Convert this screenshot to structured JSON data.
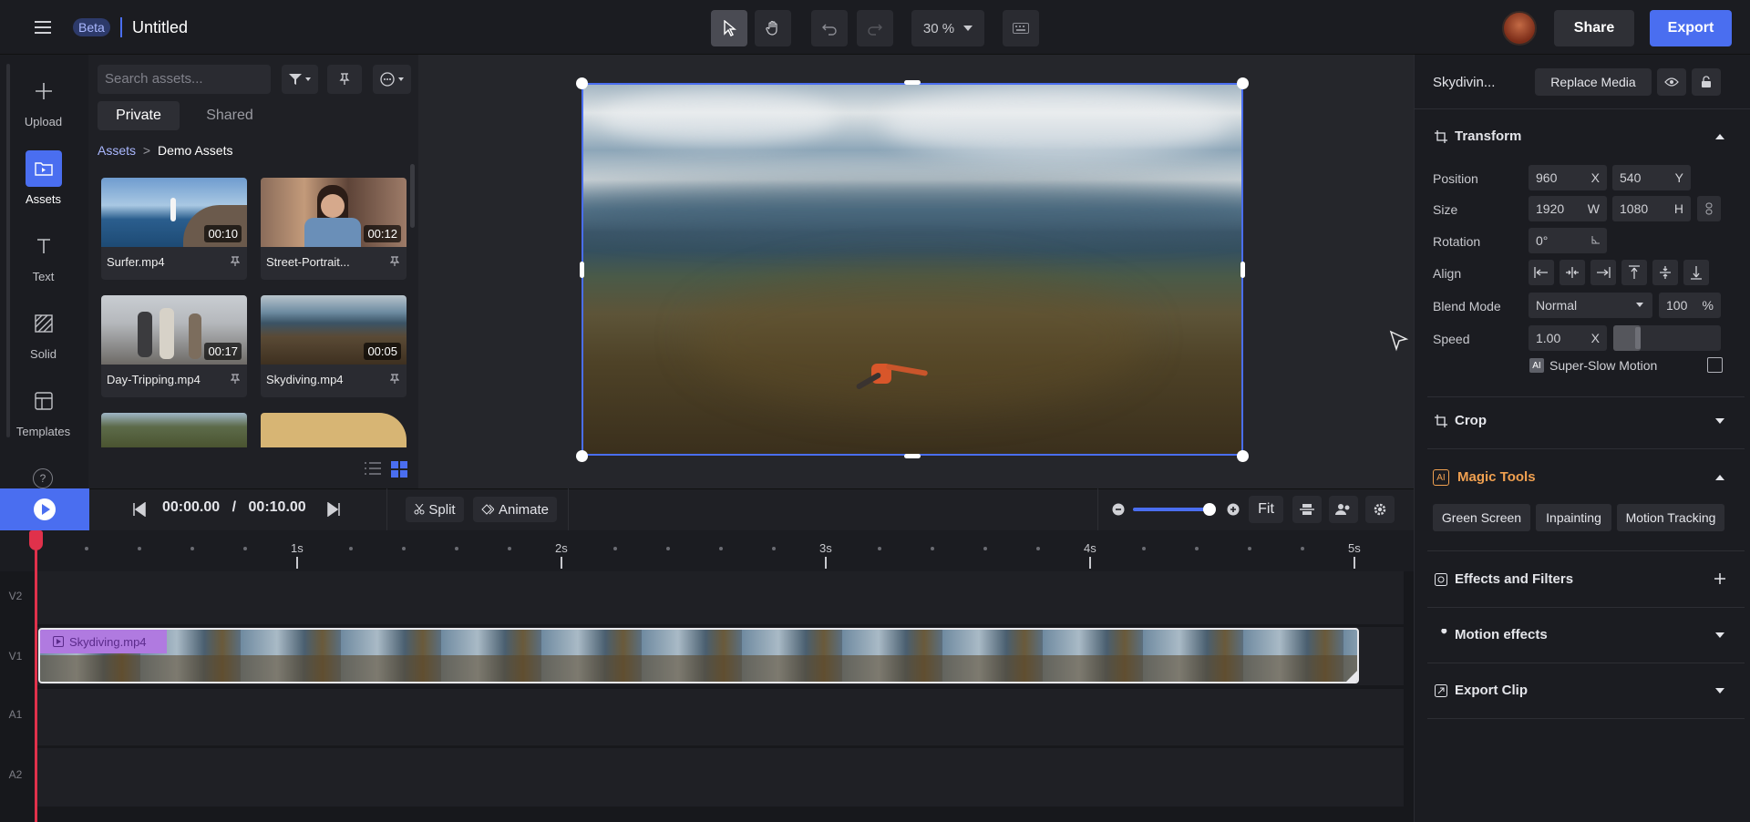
{
  "topbar": {
    "badge": "Beta",
    "title": "Untitled",
    "zoom": "30 %",
    "share_label": "Share",
    "export_label": "Export"
  },
  "rail": {
    "items": [
      {
        "label": "Upload",
        "icon": "plus-icon"
      },
      {
        "label": "Assets",
        "icon": "folder-icon"
      },
      {
        "label": "Text",
        "icon": "text-icon"
      },
      {
        "label": "Solid",
        "icon": "solid-icon"
      },
      {
        "label": "Templates",
        "icon": "templates-icon"
      }
    ]
  },
  "assets": {
    "search_placeholder": "Search assets...",
    "tab_private": "Private",
    "tab_shared": "Shared",
    "breadcrumb_root": "Assets",
    "breadcrumb_sep": ">",
    "breadcrumb_current": "Demo Assets",
    "items": [
      {
        "name": "Surfer.mp4",
        "duration": "00:10"
      },
      {
        "name": "Street-Portrait...",
        "duration": "00:12"
      },
      {
        "name": "Day-Tripping.mp4",
        "duration": "00:17"
      },
      {
        "name": "Skydiving.mp4",
        "duration": "00:05"
      }
    ]
  },
  "props": {
    "media_name": "Skydivin...",
    "replace_label": "Replace Media",
    "transform_title": "Transform",
    "position_label": "Position",
    "pos_x": "960",
    "pos_x_sfx": "X",
    "pos_y": "540",
    "pos_y_sfx": "Y",
    "size_label": "Size",
    "size_w": "1920",
    "size_w_sfx": "W",
    "size_h": "1080",
    "size_h_sfx": "H",
    "rotation_label": "Rotation",
    "rotation": "0°",
    "align_label": "Align",
    "blend_label": "Blend Mode",
    "blend_value": "Normal",
    "opacity": "100",
    "opacity_sfx": "%",
    "speed_label": "Speed",
    "speed_value": "1.00",
    "speed_sfx": "X",
    "ai_badge": "AI",
    "slowmo_label": "Super-Slow Motion",
    "crop_title": "Crop",
    "magic_title": "Magic Tools",
    "magic_badge": "AI",
    "magic_buttons": [
      "Green Screen",
      "Inpainting",
      "Motion Tracking"
    ],
    "effects_title": "Effects and Filters",
    "motion_title": "Motion effects",
    "exportclip_title": "Export Clip"
  },
  "timeline": {
    "current_time": "00:00.00",
    "sep": "/",
    "total_time": "00:10.00",
    "split_label": "Split",
    "animate_label": "Animate",
    "fit_label": "Fit",
    "zoom_level": 0.9,
    "ruler": [
      "1s",
      "2s",
      "3s",
      "4s",
      "5s"
    ],
    "tracks": [
      "V2",
      "V1",
      "A1",
      "A2"
    ],
    "clip_name": "Skydiving.mp4"
  },
  "colors": {
    "accent": "#4a6ef0",
    "playhead": "#e0314b",
    "clip_label": "#b07ae0",
    "magic": "#f0a050"
  }
}
